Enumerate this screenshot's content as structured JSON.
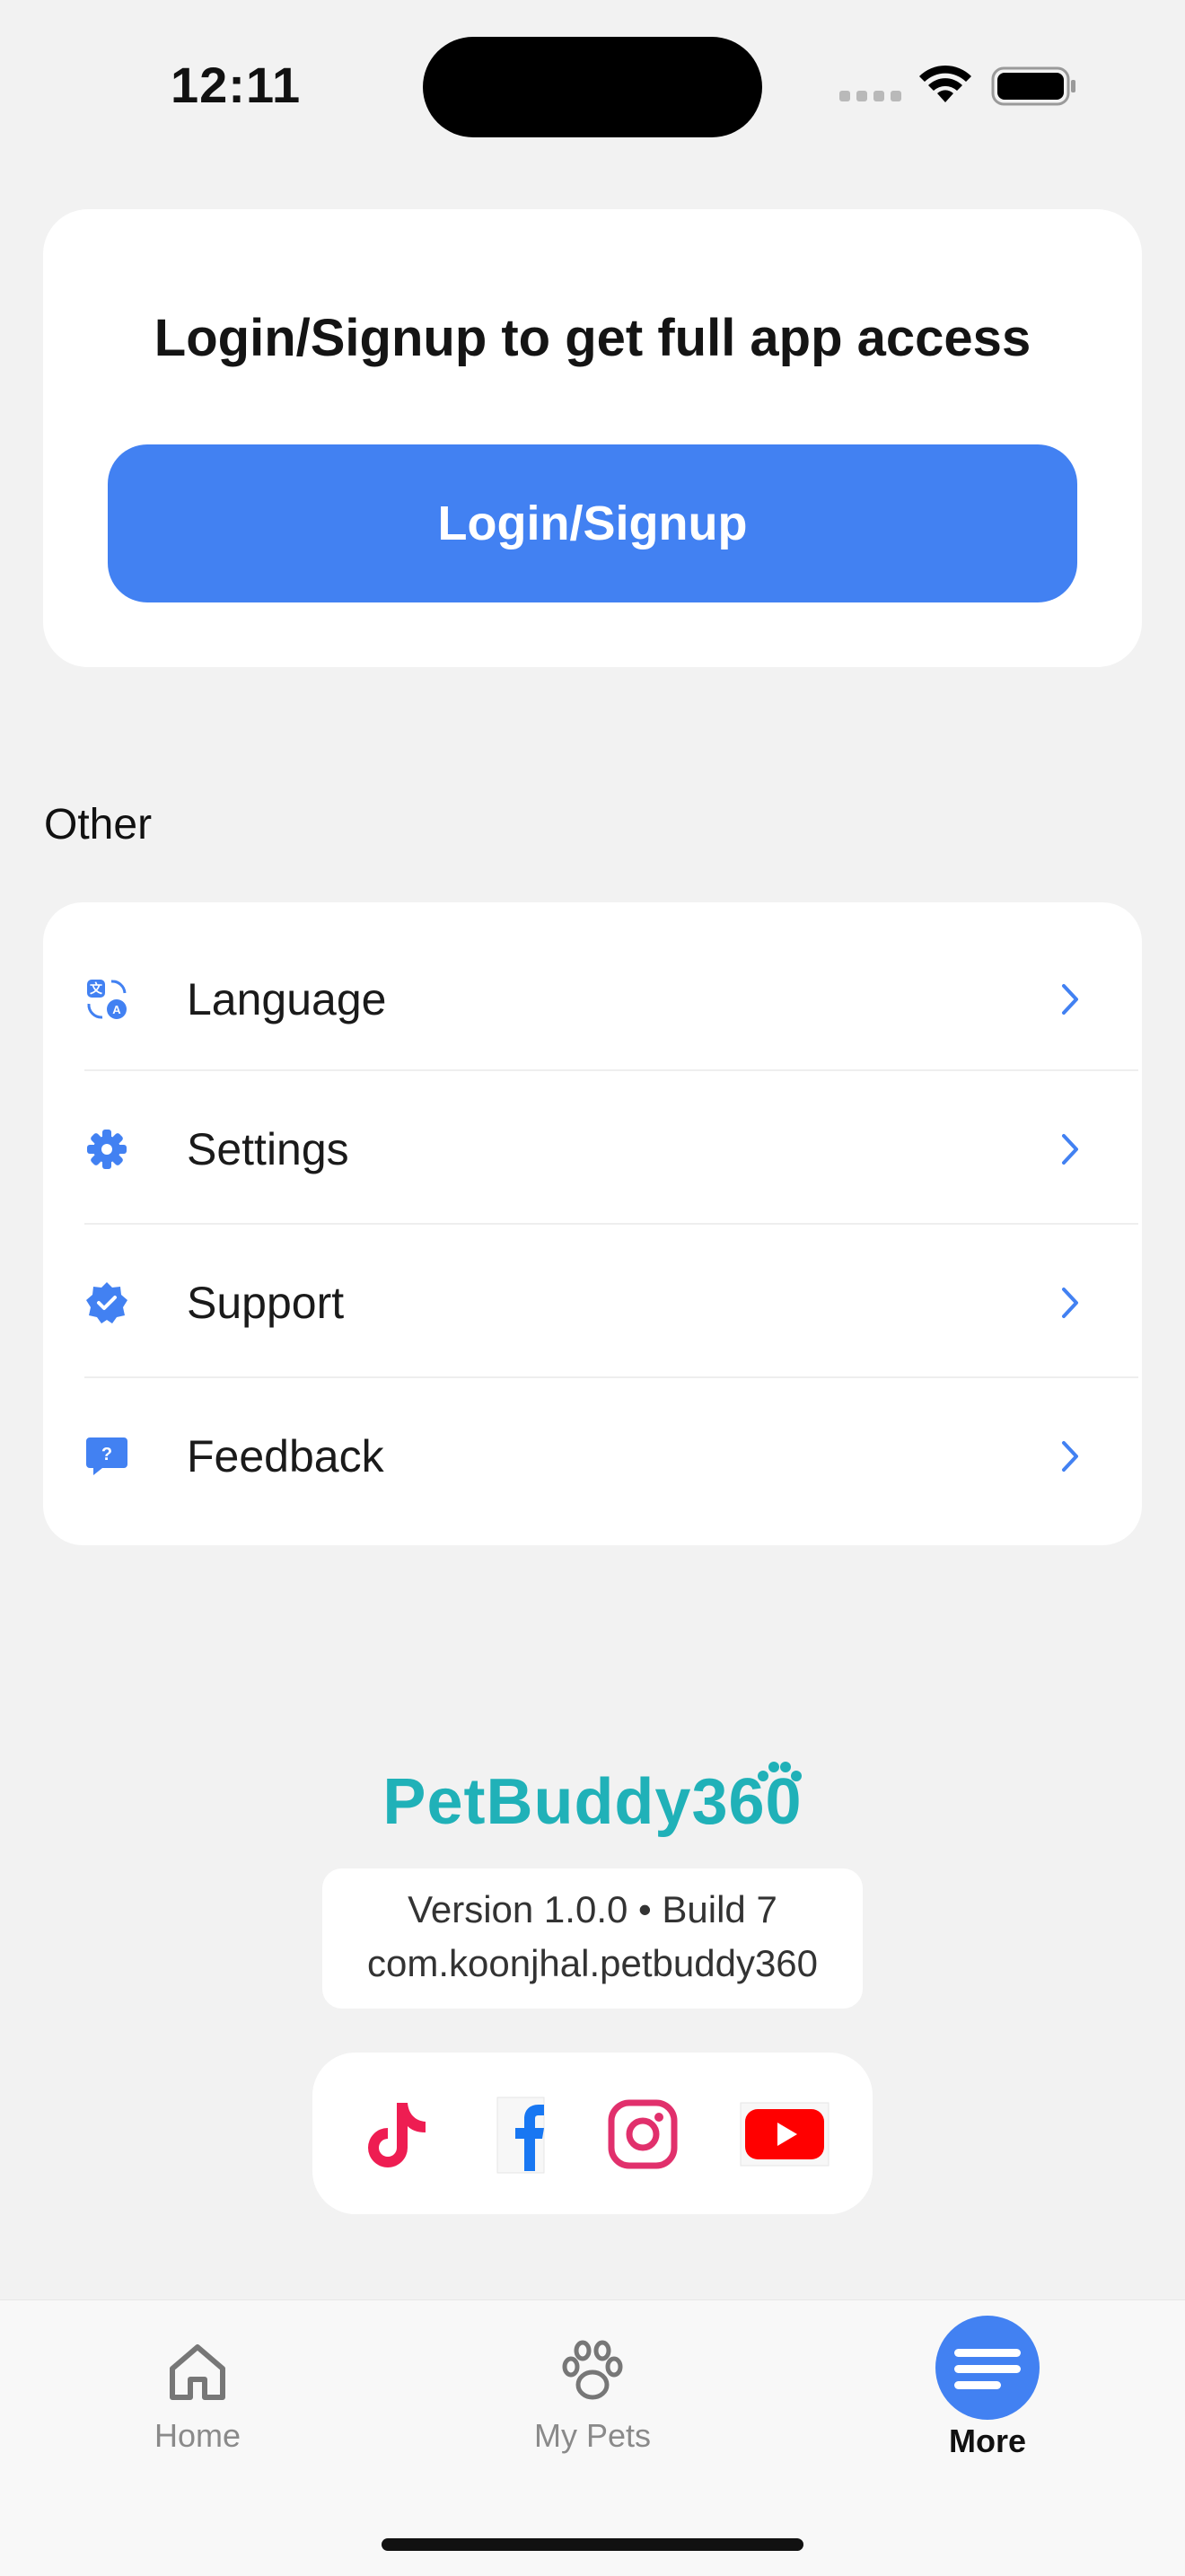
{
  "status_bar": {
    "time": "12:11",
    "icons": [
      "signal-icon",
      "wifi-icon",
      "battery-icon"
    ]
  },
  "login_card": {
    "prompt": "Login/Signup to get full app access",
    "button_label": "Login/Signup"
  },
  "other_section": {
    "title": "Other",
    "items": [
      {
        "label": "Language",
        "icon": "translate-icon"
      },
      {
        "label": "Settings",
        "icon": "gear-icon"
      },
      {
        "label": "Support",
        "icon": "verified-badge-icon"
      },
      {
        "label": "Feedback",
        "icon": "feedback-chat-icon"
      }
    ]
  },
  "branding": {
    "app_name": "PetBuddy360",
    "version": "Version 1.0.0 • Build 7",
    "bundle_id": "com.koonjhal.petbuddy360"
  },
  "social_links": [
    {
      "name": "TikTok",
      "icon": "tiktok-icon"
    },
    {
      "name": "Facebook",
      "icon": "facebook-icon"
    },
    {
      "name": "Instagram",
      "icon": "instagram-icon"
    },
    {
      "name": "YouTube",
      "icon": "youtube-icon"
    }
  ],
  "tab_bar": {
    "tabs": [
      {
        "label": "Home",
        "icon": "home-icon",
        "active": false
      },
      {
        "label": "My Pets",
        "icon": "paw-icon",
        "active": false
      },
      {
        "label": "More",
        "icon": "menu-icon",
        "active": true
      }
    ]
  },
  "colors": {
    "accent": "#4281f2",
    "background": "#f2f2f2",
    "brand": "#20b1b8"
  }
}
